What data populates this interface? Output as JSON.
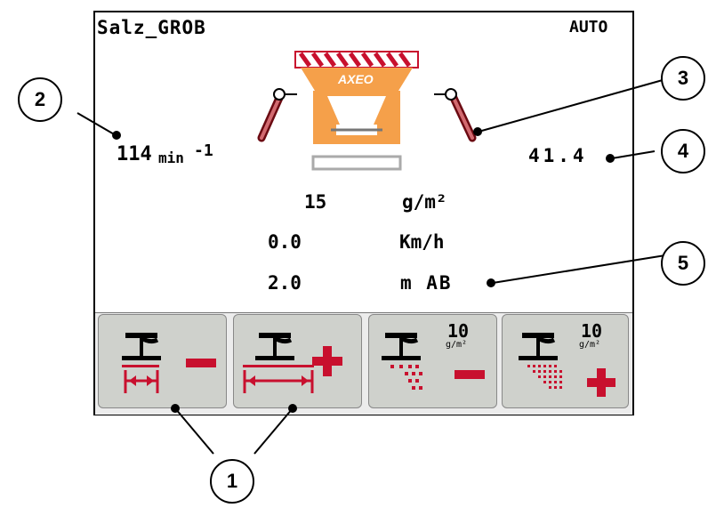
{
  "header": {
    "profile_name": "Salz_GROB",
    "mode": "AUTO"
  },
  "readouts": {
    "disc_speed_value": "114",
    "disc_speed_unit": "min",
    "disc_speed_exp": "-1",
    "right_value": "41.4",
    "rate_value": "15",
    "rate_unit": "g/m²",
    "speed_value": "0.0",
    "speed_unit": "Km/h",
    "width_value": "2.0",
    "width_unit": "m AB"
  },
  "machine": {
    "brand": "AXEO"
  },
  "softkeys": [
    {
      "name": "spread-width-decrease",
      "sign": "minus"
    },
    {
      "name": "spread-width-increase",
      "sign": "plus"
    },
    {
      "name": "rate-decrease",
      "step": "10",
      "unit": "g/m²",
      "sign": "minus"
    },
    {
      "name": "rate-increase",
      "step": "10",
      "unit": "g/m²",
      "sign": "plus"
    }
  ],
  "callouts": {
    "c1": "1",
    "c2": "2",
    "c3": "3",
    "c4": "4",
    "c5": "5"
  },
  "colors": {
    "accent_red": "#c8102e",
    "machine_orange": "#f5a04a"
  }
}
